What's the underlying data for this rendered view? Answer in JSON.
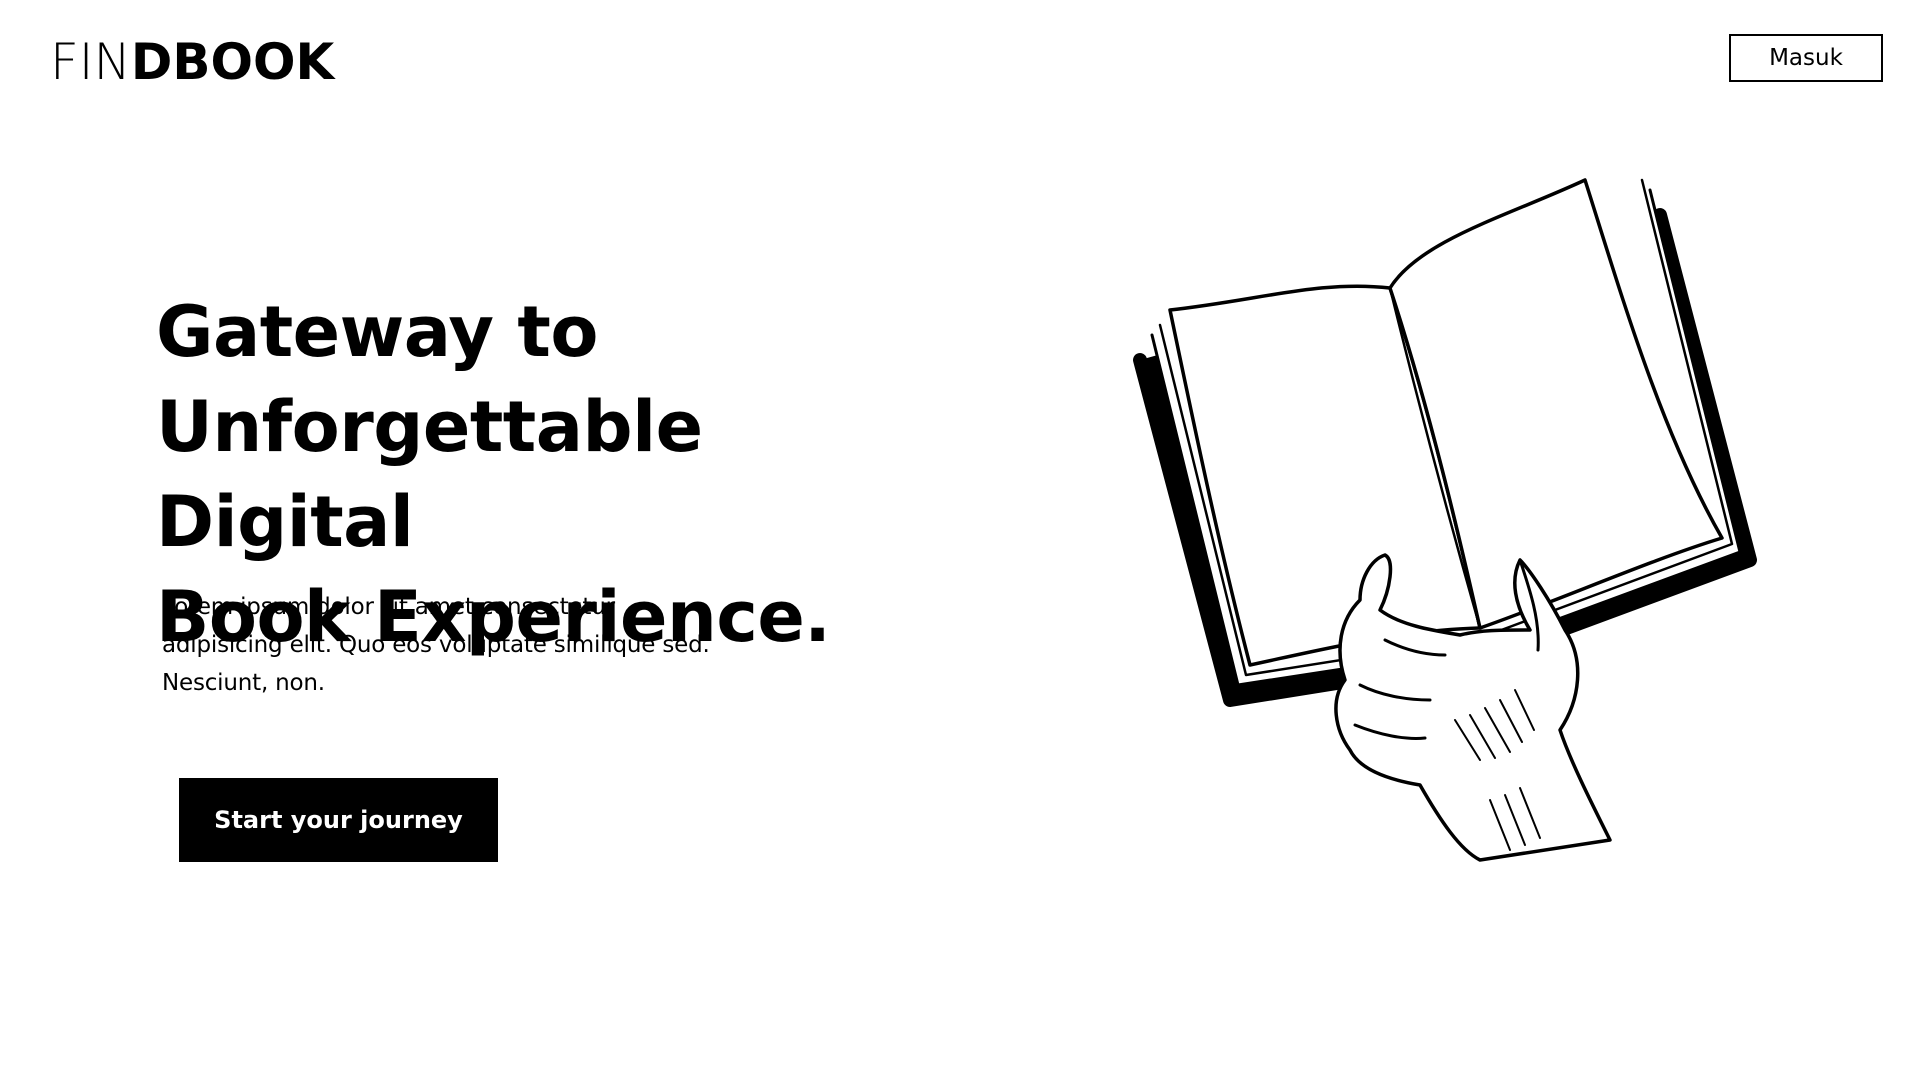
{
  "header": {
    "logo_light": "FIN",
    "logo_bold": "DBOOK",
    "login_label": "Masuk"
  },
  "hero": {
    "title_line1": "Gateway to",
    "title_line2": "Unforgettable Digital",
    "title_line3": "Book Experience.",
    "description": "Lorem ipsum dolor sit amet consectetur adipisicing elit. Quo eos voluptate similique sed. Nesciunt, non.",
    "cta_label": "Start your journey"
  },
  "illustration": {
    "icon": "hand-holding-open-book-illustration"
  },
  "colors": {
    "background": "#ffffff",
    "text": "#000000",
    "button_bg": "#000000",
    "button_text": "#ffffff"
  }
}
